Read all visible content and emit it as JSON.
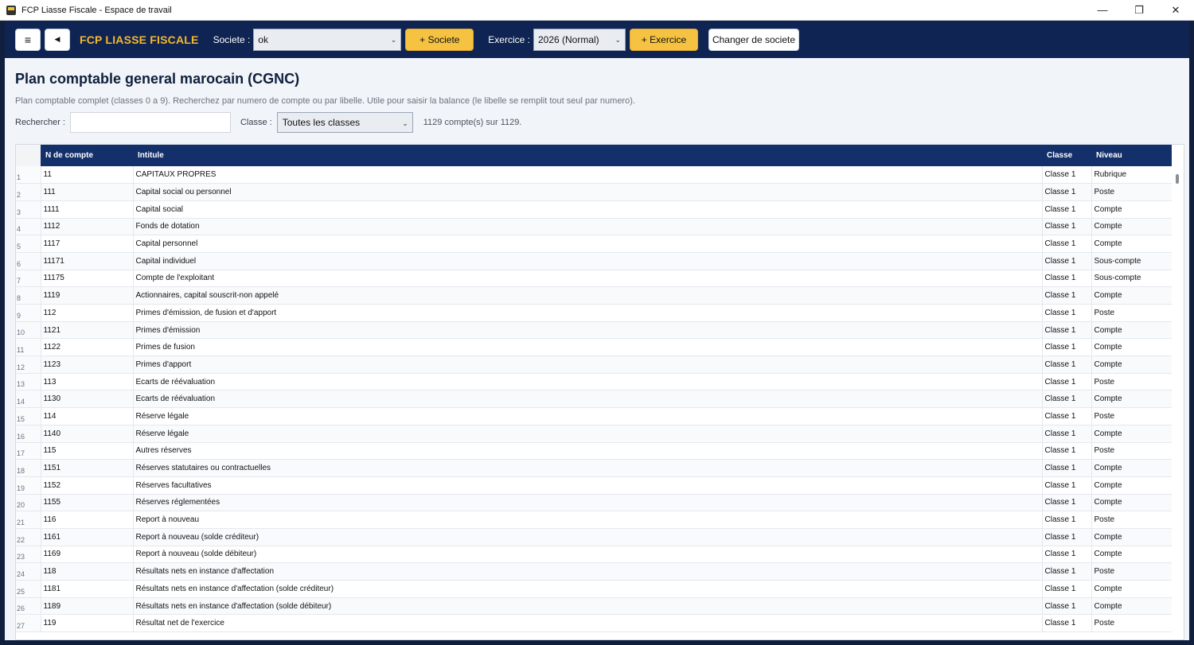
{
  "window": {
    "title": "FCP Liasse Fiscale - Espace de travail",
    "minimize": "—",
    "maximize": "❐",
    "close": "✕"
  },
  "header": {
    "menu_icon": "≡",
    "back_icon": "◀",
    "brand": "FCP LIASSE FISCALE",
    "societe_label": "Societe :",
    "societe_value": "ok",
    "add_societe": "+ Societe",
    "exercice_label": "Exercice :",
    "exercice_value": "2026 (Normal)",
    "add_exercice": "+ Exercice",
    "change_societe": "Changer de societe"
  },
  "page": {
    "title": "Plan comptable general marocain (CGNC)",
    "description": "Plan comptable complet (classes 0 a 9). Recherchez par numero de compte ou par libelle. Utile pour saisir la balance (le libelle se remplit tout seul par numero).",
    "search_label": "Rechercher :",
    "search_value": "",
    "classe_label": "Classe :",
    "classe_value": "Toutes les classes",
    "count_text": "1129 compte(s) sur 1129."
  },
  "table": {
    "columns": [
      "N de compte",
      "Intitule",
      "Classe",
      "Niveau"
    ],
    "rows": [
      [
        "1",
        "11",
        "CAPITAUX PROPRES",
        "Classe 1",
        "Rubrique"
      ],
      [
        "2",
        "111",
        "Capital social ou personnel",
        "Classe 1",
        "Poste"
      ],
      [
        "3",
        "1111",
        "Capital social",
        "Classe 1",
        "Compte"
      ],
      [
        "4",
        "1112",
        "Fonds de dotation",
        "Classe 1",
        "Compte"
      ],
      [
        "5",
        "1117",
        "Capital personnel",
        "Classe 1",
        "Compte"
      ],
      [
        "6",
        "11171",
        "Capital individuel",
        "Classe 1",
        "Sous-compte"
      ],
      [
        "7",
        "11175",
        "Compte de l'exploitant",
        "Classe 1",
        "Sous-compte"
      ],
      [
        "8",
        "1119",
        "Actionnaires, capital souscrit-non appelé",
        "Classe 1",
        "Compte"
      ],
      [
        "9",
        "112",
        "Primes d'émission, de fusion et d'apport",
        "Classe 1",
        "Poste"
      ],
      [
        "10",
        "1121",
        "Primes d'émission",
        "Classe 1",
        "Compte"
      ],
      [
        "11",
        "1122",
        "Primes de fusion",
        "Classe 1",
        "Compte"
      ],
      [
        "12",
        "1123",
        "Primes d'apport",
        "Classe 1",
        "Compte"
      ],
      [
        "13",
        "113",
        "Ecarts de réévaluation",
        "Classe 1",
        "Poste"
      ],
      [
        "14",
        "1130",
        "Ecarts de réévaluation",
        "Classe 1",
        "Compte"
      ],
      [
        "15",
        "114",
        "Réserve légale",
        "Classe 1",
        "Poste"
      ],
      [
        "16",
        "1140",
        "Réserve légale",
        "Classe 1",
        "Compte"
      ],
      [
        "17",
        "115",
        "Autres réserves",
        "Classe 1",
        "Poste"
      ],
      [
        "18",
        "1151",
        "Réserves statutaires ou contractuelles",
        "Classe 1",
        "Compte"
      ],
      [
        "19",
        "1152",
        "Réserves facultatives",
        "Classe 1",
        "Compte"
      ],
      [
        "20",
        "1155",
        "Réserves réglementées",
        "Classe 1",
        "Compte"
      ],
      [
        "21",
        "116",
        "Report à nouveau",
        "Classe 1",
        "Poste"
      ],
      [
        "22",
        "1161",
        "Report à nouveau (solde créditeur)",
        "Classe 1",
        "Compte"
      ],
      [
        "23",
        "1169",
        "Report à nouveau (solde débiteur)",
        "Classe 1",
        "Compte"
      ],
      [
        "24",
        "118",
        "Résultats nets en instance d'affectation",
        "Classe 1",
        "Poste"
      ],
      [
        "25",
        "1181",
        "Résultats nets en instance d'affectation (solde créditeur)",
        "Classe 1",
        "Compte"
      ],
      [
        "26",
        "1189",
        "Résultats nets en instance d'affectation (solde débiteur)",
        "Classe 1",
        "Compte"
      ],
      [
        "27",
        "119",
        "Résultat net de l'exercice",
        "Classe 1",
        "Poste"
      ]
    ]
  },
  "colors": {
    "header_bg": "#0f2452",
    "brand_yellow": "#f5b82e",
    "button_yellow": "#f5c242",
    "table_header": "#13306b"
  }
}
